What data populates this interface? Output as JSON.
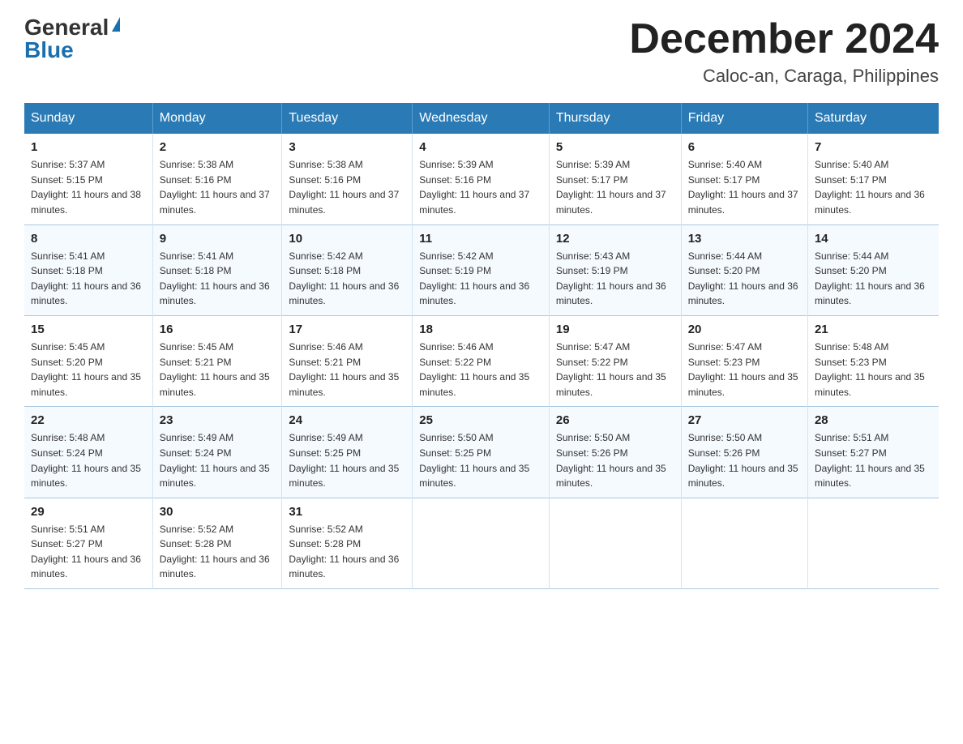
{
  "logo": {
    "general": "General",
    "blue": "Blue"
  },
  "title": "December 2024",
  "subtitle": "Caloc-an, Caraga, Philippines",
  "days_of_week": [
    "Sunday",
    "Monday",
    "Tuesday",
    "Wednesday",
    "Thursday",
    "Friday",
    "Saturday"
  ],
  "weeks": [
    [
      {
        "day": "1",
        "sunrise": "5:37 AM",
        "sunset": "5:15 PM",
        "daylight": "11 hours and 38 minutes."
      },
      {
        "day": "2",
        "sunrise": "5:38 AM",
        "sunset": "5:16 PM",
        "daylight": "11 hours and 37 minutes."
      },
      {
        "day": "3",
        "sunrise": "5:38 AM",
        "sunset": "5:16 PM",
        "daylight": "11 hours and 37 minutes."
      },
      {
        "day": "4",
        "sunrise": "5:39 AM",
        "sunset": "5:16 PM",
        "daylight": "11 hours and 37 minutes."
      },
      {
        "day": "5",
        "sunrise": "5:39 AM",
        "sunset": "5:17 PM",
        "daylight": "11 hours and 37 minutes."
      },
      {
        "day": "6",
        "sunrise": "5:40 AM",
        "sunset": "5:17 PM",
        "daylight": "11 hours and 37 minutes."
      },
      {
        "day": "7",
        "sunrise": "5:40 AM",
        "sunset": "5:17 PM",
        "daylight": "11 hours and 36 minutes."
      }
    ],
    [
      {
        "day": "8",
        "sunrise": "5:41 AM",
        "sunset": "5:18 PM",
        "daylight": "11 hours and 36 minutes."
      },
      {
        "day": "9",
        "sunrise": "5:41 AM",
        "sunset": "5:18 PM",
        "daylight": "11 hours and 36 minutes."
      },
      {
        "day": "10",
        "sunrise": "5:42 AM",
        "sunset": "5:18 PM",
        "daylight": "11 hours and 36 minutes."
      },
      {
        "day": "11",
        "sunrise": "5:42 AM",
        "sunset": "5:19 PM",
        "daylight": "11 hours and 36 minutes."
      },
      {
        "day": "12",
        "sunrise": "5:43 AM",
        "sunset": "5:19 PM",
        "daylight": "11 hours and 36 minutes."
      },
      {
        "day": "13",
        "sunrise": "5:44 AM",
        "sunset": "5:20 PM",
        "daylight": "11 hours and 36 minutes."
      },
      {
        "day": "14",
        "sunrise": "5:44 AM",
        "sunset": "5:20 PM",
        "daylight": "11 hours and 36 minutes."
      }
    ],
    [
      {
        "day": "15",
        "sunrise": "5:45 AM",
        "sunset": "5:20 PM",
        "daylight": "11 hours and 35 minutes."
      },
      {
        "day": "16",
        "sunrise": "5:45 AM",
        "sunset": "5:21 PM",
        "daylight": "11 hours and 35 minutes."
      },
      {
        "day": "17",
        "sunrise": "5:46 AM",
        "sunset": "5:21 PM",
        "daylight": "11 hours and 35 minutes."
      },
      {
        "day": "18",
        "sunrise": "5:46 AM",
        "sunset": "5:22 PM",
        "daylight": "11 hours and 35 minutes."
      },
      {
        "day": "19",
        "sunrise": "5:47 AM",
        "sunset": "5:22 PM",
        "daylight": "11 hours and 35 minutes."
      },
      {
        "day": "20",
        "sunrise": "5:47 AM",
        "sunset": "5:23 PM",
        "daylight": "11 hours and 35 minutes."
      },
      {
        "day": "21",
        "sunrise": "5:48 AM",
        "sunset": "5:23 PM",
        "daylight": "11 hours and 35 minutes."
      }
    ],
    [
      {
        "day": "22",
        "sunrise": "5:48 AM",
        "sunset": "5:24 PM",
        "daylight": "11 hours and 35 minutes."
      },
      {
        "day": "23",
        "sunrise": "5:49 AM",
        "sunset": "5:24 PM",
        "daylight": "11 hours and 35 minutes."
      },
      {
        "day": "24",
        "sunrise": "5:49 AM",
        "sunset": "5:25 PM",
        "daylight": "11 hours and 35 minutes."
      },
      {
        "day": "25",
        "sunrise": "5:50 AM",
        "sunset": "5:25 PM",
        "daylight": "11 hours and 35 minutes."
      },
      {
        "day": "26",
        "sunrise": "5:50 AM",
        "sunset": "5:26 PM",
        "daylight": "11 hours and 35 minutes."
      },
      {
        "day": "27",
        "sunrise": "5:50 AM",
        "sunset": "5:26 PM",
        "daylight": "11 hours and 35 minutes."
      },
      {
        "day": "28",
        "sunrise": "5:51 AM",
        "sunset": "5:27 PM",
        "daylight": "11 hours and 35 minutes."
      }
    ],
    [
      {
        "day": "29",
        "sunrise": "5:51 AM",
        "sunset": "5:27 PM",
        "daylight": "11 hours and 36 minutes."
      },
      {
        "day": "30",
        "sunrise": "5:52 AM",
        "sunset": "5:28 PM",
        "daylight": "11 hours and 36 minutes."
      },
      {
        "day": "31",
        "sunrise": "5:52 AM",
        "sunset": "5:28 PM",
        "daylight": "11 hours and 36 minutes."
      },
      null,
      null,
      null,
      null
    ]
  ],
  "labels": {
    "sunrise": "Sunrise:",
    "sunset": "Sunset:",
    "daylight": "Daylight:"
  }
}
